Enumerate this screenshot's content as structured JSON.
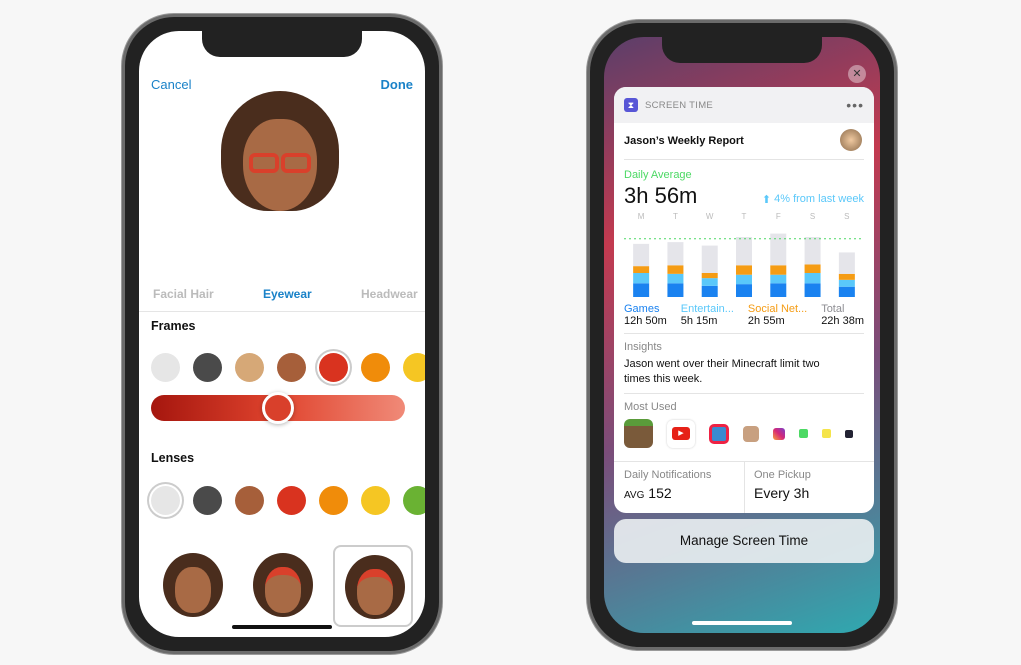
{
  "memoji_editor": {
    "cancel_label": "Cancel",
    "done_label": "Done",
    "tabs": [
      {
        "label": "Facial Hair"
      },
      {
        "label": "Eyewear",
        "active": true
      },
      {
        "label": "Headwear"
      }
    ],
    "frames_label": "Frames",
    "frame_colors": [
      "#e6e6e6",
      "#4a4a4a",
      "#d6a877",
      "#a65f3a",
      "#d9331f",
      "#f08c0a",
      "#f5c623"
    ],
    "frame_selected_index": 4,
    "frame_shade_slider": 0.5,
    "lenses_label": "Lenses",
    "lens_colors": [
      "#e6e6e6",
      "#4a4a4a",
      "#a65f3a",
      "#d9331f",
      "#f08c0a",
      "#f5c623",
      "#6ab233"
    ],
    "lens_selected_index": 0,
    "accent": "#1a82c8"
  },
  "screen_time": {
    "widget_title": "SCREEN TIME",
    "more_icon": "ellipsis-icon",
    "close_icon": "close-icon",
    "report_title": "Jason’s Weekly Report",
    "daily_average_label": "Daily Average",
    "daily_average_value": "3h 56m",
    "change_text": "4% from last week",
    "categories": [
      {
        "label": "Games",
        "value": "12h 50m",
        "color": "#1a82f0"
      },
      {
        "label": "Entertain...",
        "value": "5h 15m",
        "color": "#5ac8fa"
      },
      {
        "label": "Social Net...",
        "value": "2h 55m",
        "color": "#f59c14"
      },
      {
        "label": "Total",
        "value": "22h 38m",
        "color": "#8e8e93"
      }
    ],
    "insights_label": "Insights",
    "insights_text": "Jason went over their Minecraft limit two times this week.",
    "most_used_label": "Most Used",
    "most_used_apps": [
      "Minecraft",
      "YouTube",
      "Game",
      "Contact",
      "Instagram",
      "Messages",
      "Notes",
      "App"
    ],
    "notifications_label": "Daily Notifications",
    "notifications_prefix": "AVG",
    "notifications_value": "152",
    "pickup_label": "One Pickup",
    "pickup_value": "Every 3h",
    "manage_button": "Manage Screen Time"
  },
  "chart_data": {
    "type": "bar",
    "stacked": true,
    "categories": [
      "M",
      "T",
      "W",
      "T",
      "F",
      "S",
      "S"
    ],
    "series": [
      {
        "name": "Games",
        "values": [
          0.8,
          0.8,
          0.65,
          0.75,
          0.8,
          0.8,
          0.6
        ]
      },
      {
        "name": "Entertain...",
        "values": [
          0.6,
          0.55,
          0.45,
          0.55,
          0.5,
          0.6,
          0.4
        ]
      },
      {
        "name": "Social Net...",
        "values": [
          0.4,
          0.5,
          0.3,
          0.55,
          0.55,
          0.5,
          0.35
        ]
      },
      {
        "values": [
          1.3,
          1.35,
          1.6,
          1.65,
          1.85,
          1.6,
          1.25
        ]
      }
    ],
    "average_line": 3.4,
    "colors": [
      "#1a82f0",
      "#5ac8fa",
      "#f59c14",
      "#e5e5ea"
    ],
    "average_line_color": "#4cd964"
  }
}
